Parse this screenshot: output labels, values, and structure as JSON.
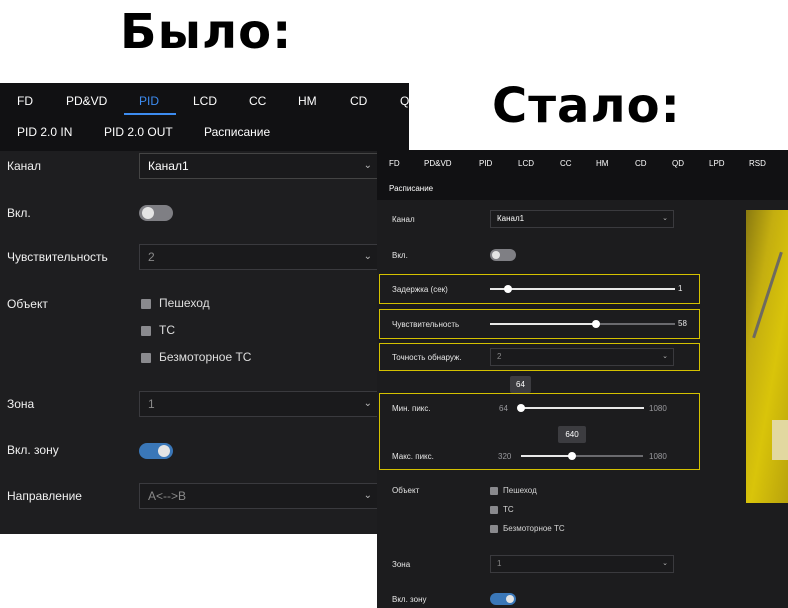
{
  "headings": {
    "before": "Было:",
    "after": "Стало:"
  },
  "before": {
    "tabs": [
      "FD",
      "PD&VD",
      "PID",
      "LCD",
      "CC",
      "HM",
      "CD",
      "Q"
    ],
    "active_tab": "PID",
    "subtabs": [
      "PID 2.0 IN",
      "PID 2.0 OUT",
      "Расписание"
    ],
    "channel": {
      "label": "Канал",
      "value": "Канал1"
    },
    "enable": {
      "label": "Вкл.",
      "on": false
    },
    "sensitivity": {
      "label": "Чувствительность",
      "value": "2"
    },
    "object": {
      "label": "Объект",
      "options": [
        "Пешеход",
        "ТС",
        "Безмоторное ТС"
      ]
    },
    "zone": {
      "label": "Зона",
      "value": "1"
    },
    "zone_enable": {
      "label": "Вкл. зону",
      "on": true
    },
    "direction": {
      "label": "Направление",
      "value": "A<-->B"
    }
  },
  "after": {
    "tabs": [
      "FD",
      "PD&VD",
      "PID",
      "LCD",
      "CC",
      "HM",
      "CD",
      "QD",
      "LPD",
      "RSD"
    ],
    "schedule_tab": "Расписание",
    "channel": {
      "label": "Канал",
      "value": "Канал1"
    },
    "enable": {
      "label": "Вкл.",
      "on": false
    },
    "delay": {
      "label": "Задержка (сек)",
      "value": "1",
      "fraction": 0.1
    },
    "sensitivity": {
      "label": "Чувствительность",
      "value": "58",
      "fraction": 0.58
    },
    "accuracy": {
      "label": "Точность обнаруж.",
      "value": "2"
    },
    "min_pixels": {
      "label": "Мин. пикс.",
      "min": "64",
      "max": "1080",
      "value": "64",
      "fraction": 0.0
    },
    "max_pixels": {
      "label": "Макс. пикс.",
      "min": "320",
      "max": "1080",
      "value": "640",
      "fraction": 0.42
    },
    "object": {
      "label": "Объект",
      "options": [
        "Пешеход",
        "ТС",
        "Безмоторное ТС"
      ]
    },
    "zone": {
      "label": "Зона",
      "value": "1"
    },
    "zone_enable": {
      "label": "Вкл. зону",
      "on": true
    }
  },
  "colors": {
    "accent": "#3d8cf0",
    "highlight": "#d4c100",
    "toggle_on": "#3a77b8"
  }
}
